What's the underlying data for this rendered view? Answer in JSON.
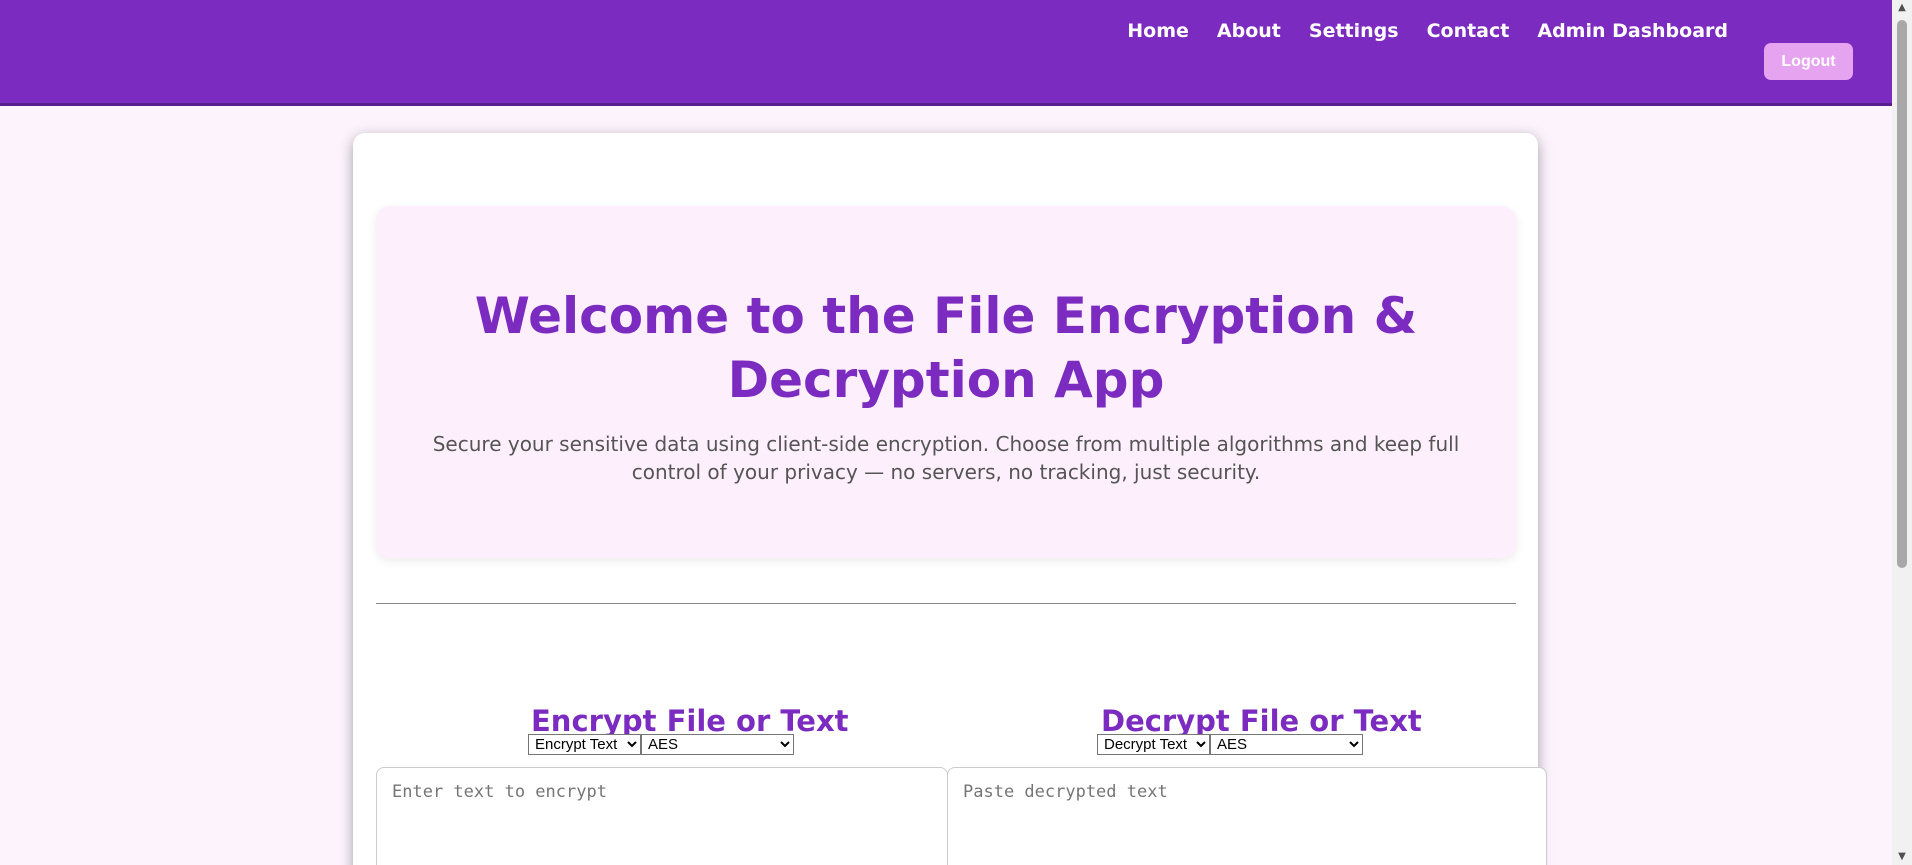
{
  "nav": {
    "items": [
      {
        "label": "Home"
      },
      {
        "label": "About"
      },
      {
        "label": "Settings"
      },
      {
        "label": "Contact"
      },
      {
        "label": "Admin Dashboard"
      }
    ],
    "logout_label": "Logout"
  },
  "hero": {
    "title": "Welcome to the File Encryption & Decryption App",
    "description": "Secure your sensitive data using client-side encryption. Choose from multiple algorithms and keep full control of your privacy — no servers, no tracking, just security."
  },
  "encrypt": {
    "title": "Encrypt File or Text",
    "mode_selected": "Encrypt Text",
    "algorithm_selected": "AES",
    "placeholder": "Enter text to encrypt",
    "value": ""
  },
  "decrypt": {
    "title": "Decrypt File or Text",
    "mode_selected": "Decrypt Text",
    "algorithm_selected": "AES",
    "placeholder": "Paste decrypted text",
    "value": ""
  },
  "colors": {
    "accent": "#7b2bbf",
    "logout_button": "#e5a3f0",
    "page_background": "#fcf3fd",
    "hero_background": "#fdf0fc"
  }
}
